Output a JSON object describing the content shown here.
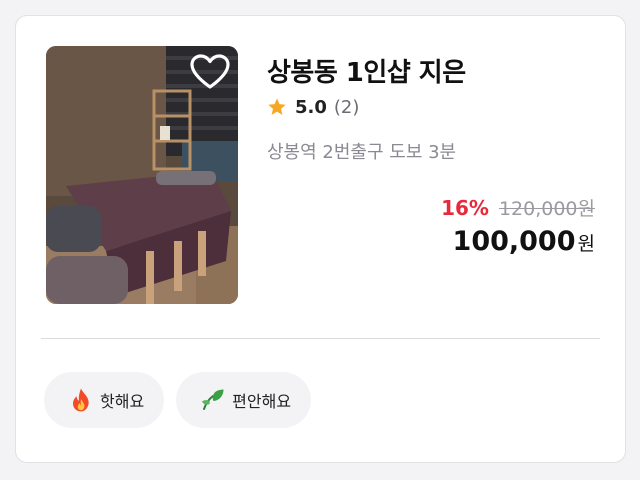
{
  "card": {
    "title": "상봉동 1인샵 지은",
    "rating": "5.0",
    "review_count": "(2)",
    "location": "상봉역 2번출구 도보 3분",
    "discount": "16%",
    "original_price": "120,000원",
    "final_price": "100,000",
    "currency_unit": "원",
    "favorite_icon": "heart-outline-icon",
    "star_color": "#f7a823",
    "discount_color": "#e8293a"
  },
  "tags": [
    {
      "icon": "fire-icon",
      "label": "핫해요"
    },
    {
      "icon": "leaf-icon",
      "label": "편안해요"
    }
  ]
}
